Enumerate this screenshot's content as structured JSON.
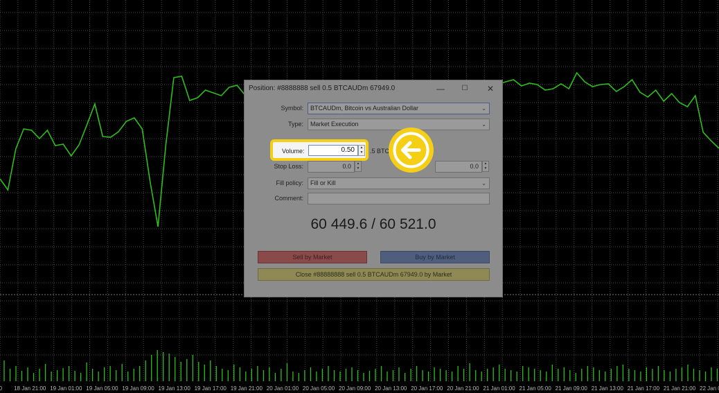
{
  "chart": {
    "line_color": "#2fbf1c",
    "grid_color": "#4a4a4a",
    "line_points": [
      258,
      274,
      215,
      186,
      188,
      200,
      188,
      210,
      208,
      225,
      209,
      180,
      150,
      197,
      198,
      190,
      175,
      170,
      186,
      262,
      327,
      208,
      112,
      110,
      145,
      141,
      130,
      134,
      138,
      126,
      123,
      137,
      150,
      162,
      176,
      188,
      179,
      171,
      168,
      159,
      152,
      150,
      148,
      145,
      144,
      140,
      138,
      136,
      134,
      133,
      131,
      130,
      129,
      128,
      127,
      126,
      125,
      124,
      124,
      123,
      125,
      128,
      126,
      122,
      118,
      115,
      124,
      120,
      122,
      130,
      128,
      121,
      128,
      105,
      118,
      125,
      122,
      121,
      132,
      125,
      115,
      133,
      140,
      130,
      146,
      135,
      148,
      154,
      138,
      191,
      203,
      214
    ],
    "volume_bars": [
      30,
      18,
      22,
      15,
      20,
      12,
      18,
      25,
      14,
      16,
      19,
      22,
      15,
      12,
      27,
      18,
      14,
      20,
      22,
      16,
      25,
      14,
      18,
      22,
      30,
      38,
      45,
      42,
      40,
      35,
      28,
      32,
      38,
      28,
      24,
      30,
      22,
      18,
      16,
      24,
      20,
      14,
      18,
      22,
      16,
      20,
      12,
      18,
      26,
      14,
      12,
      16,
      20,
      14,
      18,
      22,
      16,
      14,
      18,
      20,
      16,
      12,
      15,
      18,
      22,
      14,
      16,
      20,
      12,
      18,
      22,
      16,
      14,
      20,
      18,
      16,
      14,
      22,
      18,
      26,
      16,
      14,
      18,
      20,
      24,
      18,
      16,
      14,
      22,
      20,
      18,
      16,
      14,
      24,
      18,
      20,
      16,
      12,
      18,
      22,
      20,
      16,
      14,
      18,
      22,
      24,
      18,
      16,
      14,
      20,
      18,
      22,
      16,
      14,
      18,
      20,
      24,
      18,
      16,
      14,
      20,
      18
    ],
    "time_labels": [
      ":00",
      "18 Jan 21:00",
      "19 Jan 01:00",
      "19 Jan 05:00",
      "19 Jan 09:00",
      "19 Jan 13:00",
      "19 Jan 17:00",
      "19 Jan 21:00",
      "20 Jan 01:00",
      "20 Jan 05:00",
      "20 Jan 09:00",
      "20 Jan 13:00",
      "20 Jan 17:00",
      "20 Jan 21:00",
      "21 Jan 01:00",
      "21 Jan 05:00",
      "21 Jan 09:00",
      "21 Jan 13:00",
      "21 Jan 17:00",
      "21 Jan 21:00",
      "22 Jan 0"
    ]
  },
  "dialog": {
    "title": "Position: #8888888 sell 0.5 BTCAUDm 67949.0",
    "symbol_label": "Symbol:",
    "symbol_value": "BTCAUDm, Bitcoin vs Australian Dollar",
    "type_label": "Type:",
    "type_value": "Market Execution",
    "volume_label": "Volume:",
    "volume_value": "0.50",
    "volume_unit": ".5 BTC",
    "stop_loss_label": "Stop Loss:",
    "stop_loss_value": "0.0",
    "take_profit_value": "0.0",
    "fill_policy_label": "Fill policy:",
    "fill_policy_value": "Fill or Kill",
    "comment_label": "Comment:",
    "comment_value": "",
    "price_display": "60 449.6 / 60 521.0",
    "sell_button": "Sell by Market",
    "buy_button": "Buy by Market",
    "close_button": "Close  #88888888  sell 0.5 BTCAUDm 67949.0 by Market",
    "minimize_glyph": "—",
    "maximize_glyph": "☐",
    "close_glyph": "✕"
  },
  "highlight": {
    "color": "#f5cf16",
    "icon": "arrow-left-icon"
  }
}
